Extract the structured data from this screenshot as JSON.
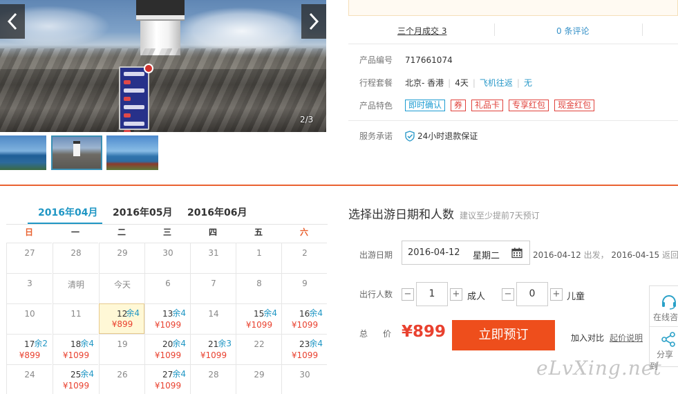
{
  "gallery": {
    "counter": "2/3",
    "prev_icon": "chevron-left-icon",
    "next_icon": "chevron-right-icon"
  },
  "stats": {
    "deals": "三个月成交 3",
    "reviews": "0 条评论"
  },
  "product": {
    "id_label": "产品编号",
    "id_value": "717661074",
    "package_label": "行程套餐",
    "route": "北京- 香港",
    "days": "4天",
    "transport": "飞机往返",
    "extra": "无",
    "features_label": "产品特色",
    "features": [
      "即时确认",
      "券",
      "礼品卡",
      "专享红包",
      "现金红包"
    ],
    "service_label": "服务承诺",
    "service_value": "24小时退款保证"
  },
  "calendar": {
    "tabs": [
      "2016年04月",
      "2016年05月",
      "2016年06月"
    ],
    "weekdays": [
      "日",
      "一",
      "二",
      "三",
      "四",
      "五",
      "六"
    ],
    "rows": [
      [
        {
          "n": "27"
        },
        {
          "n": "28"
        },
        {
          "n": "29"
        },
        {
          "n": "30"
        },
        {
          "n": "31"
        },
        {
          "n": "1"
        },
        {
          "n": "2"
        }
      ],
      [
        {
          "n": "3"
        },
        {
          "n": "清明"
        },
        {
          "n": "今天"
        },
        {
          "n": "6"
        },
        {
          "n": "7"
        },
        {
          "n": "8"
        },
        {
          "n": "9"
        }
      ],
      [
        {
          "n": "10"
        },
        {
          "n": "11"
        },
        {
          "n": "12",
          "s": "余4",
          "p": "¥899",
          "sel": true
        },
        {
          "n": "13",
          "s": "余4",
          "p": "¥1099"
        },
        {
          "n": "14"
        },
        {
          "n": "15",
          "s": "余4",
          "p": "¥1099"
        },
        {
          "n": "16",
          "s": "余4",
          "p": "¥1099"
        }
      ],
      [
        {
          "n": "17",
          "s": "余2",
          "p": "¥899"
        },
        {
          "n": "18",
          "s": "余4",
          "p": "¥1099"
        },
        {
          "n": "19"
        },
        {
          "n": "20",
          "s": "余4",
          "p": "¥1099"
        },
        {
          "n": "21",
          "s": "余3",
          "p": "¥1099"
        },
        {
          "n": "22"
        },
        {
          "n": "23",
          "s": "余4",
          "p": "¥1099"
        }
      ],
      [
        {
          "n": "24"
        },
        {
          "n": "25",
          "s": "余4",
          "p": "¥1099"
        },
        {
          "n": "26"
        },
        {
          "n": "27",
          "s": "余4",
          "p": "¥1099"
        },
        {
          "n": "28"
        },
        {
          "n": "29"
        },
        {
          "n": "30"
        }
      ]
    ]
  },
  "booking": {
    "title": "选择出游日期和人数",
    "hint": "建议至少提前7天预订",
    "date_label": "出游日期",
    "date_value": "2016-04-12",
    "weekday_value": "星期二",
    "depart_date": "2016-04-12",
    "depart_text": "出发，",
    "return_date": "2016-04-15",
    "return_text": "返回",
    "people_label": "出行人数",
    "adults": "1",
    "adult_unit": "成人",
    "children": "0",
    "child_unit": "儿童",
    "total_label": "总价",
    "total_value": "¥899",
    "book_button": "立即预订",
    "compare": "加入对比",
    "price_note": "起价说明"
  },
  "float_panel": {
    "consult": "在线咨",
    "share": "分享到"
  },
  "watermark": "eLvXing.net",
  "colors": {
    "accent_orange": "#ee4e1c",
    "link_blue": "#1f96c4",
    "price_red": "#e9412f"
  }
}
